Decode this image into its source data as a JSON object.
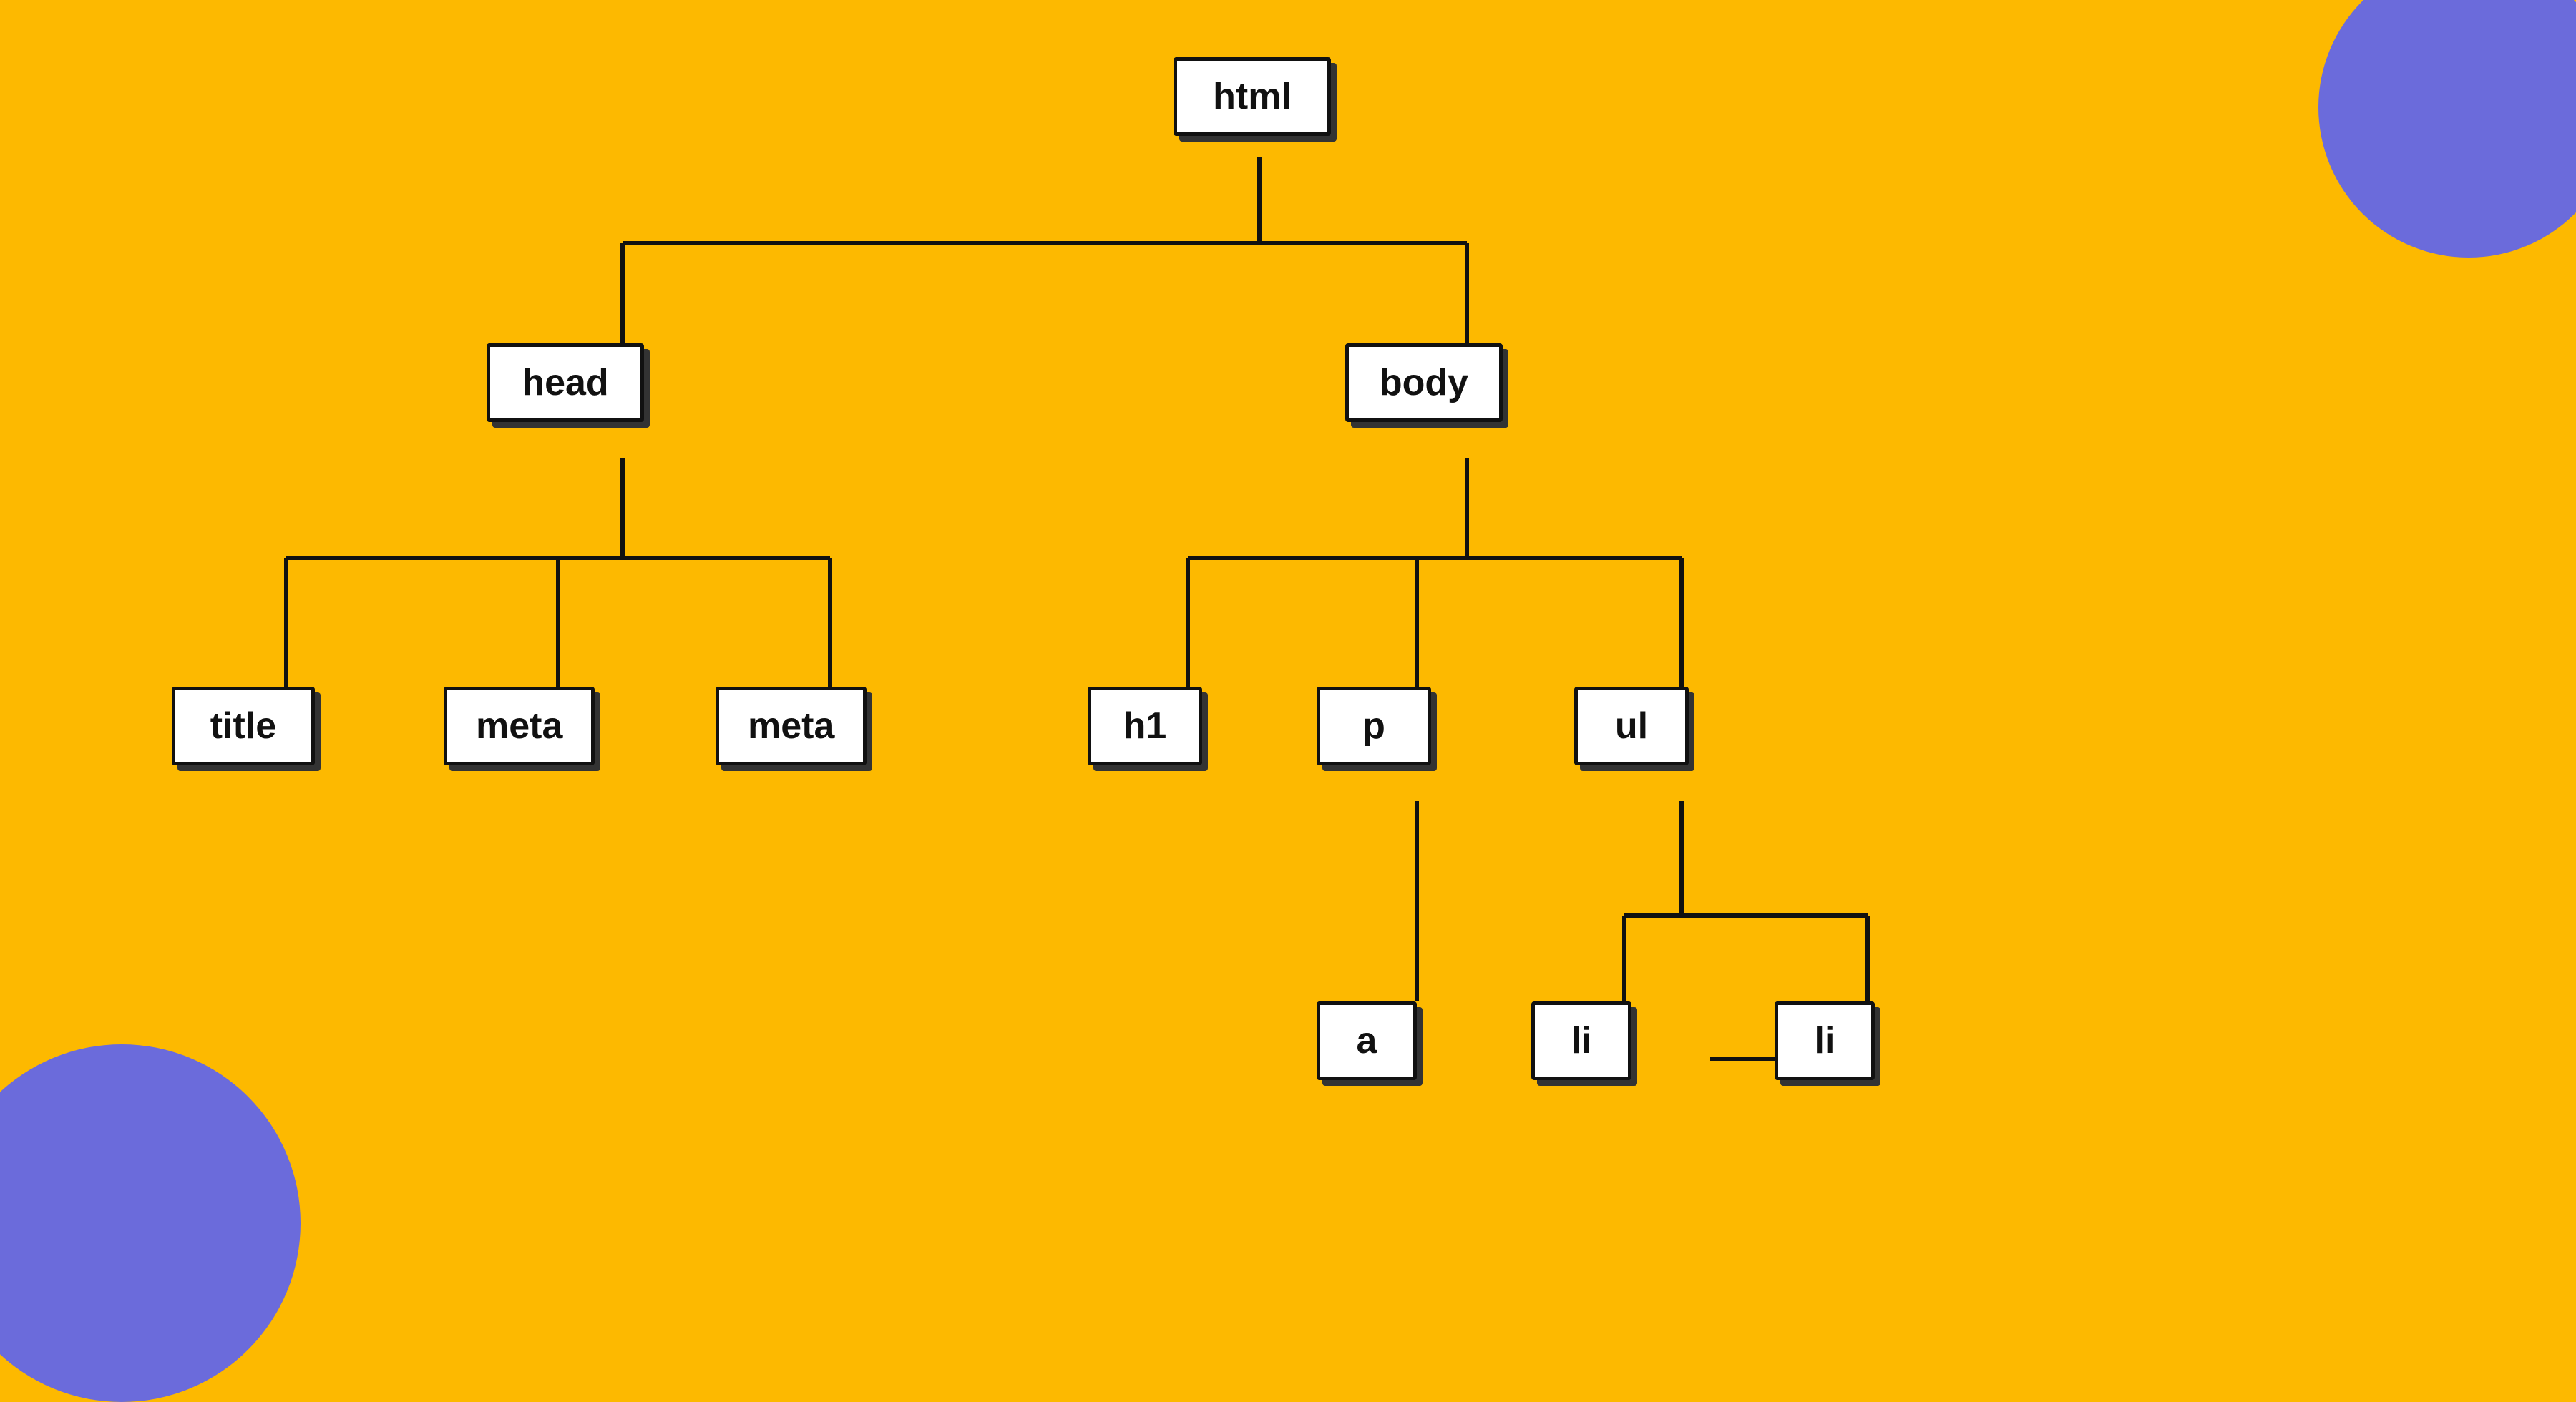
{
  "background_color": "#FDB900",
  "accent_color": "#6B6BDB",
  "nodes": {
    "html": {
      "label": "html"
    },
    "head": {
      "label": "head"
    },
    "body": {
      "label": "body"
    },
    "title": {
      "label": "title"
    },
    "meta1": {
      "label": "meta"
    },
    "meta2": {
      "label": "meta"
    },
    "h1": {
      "label": "h1"
    },
    "p": {
      "label": "p"
    },
    "ul": {
      "label": "ul"
    },
    "a": {
      "label": "a"
    },
    "li1": {
      "label": "li"
    },
    "li2": {
      "label": "li"
    }
  }
}
